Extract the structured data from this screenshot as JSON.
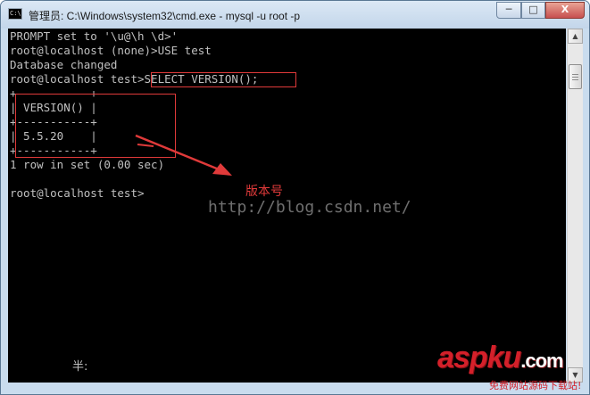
{
  "window": {
    "title": "管理员: C:\\Windows\\system32\\cmd.exe - mysql  -u root -p",
    "app_icon_label": "C:\\",
    "controls": {
      "minimize": "─",
      "maximize": "□",
      "close": "X"
    }
  },
  "console": {
    "lines": [
      "PROMPT set to '\\u@\\h \\d>'",
      "root@localhost (none)>USE test",
      "Database changed",
      "root@localhost test>SELECT VERSION();",
      "+-----------+",
      "| VERSION() |",
      "+-----------+",
      "| 5.5.20    |",
      "+-----------+",
      "1 row in set (0.00 sec)",
      "",
      "root@localhost test>"
    ],
    "ime_status": "半:"
  },
  "scrollbar": {
    "up_arrow": "▲",
    "down_arrow": "▼"
  },
  "annotations": {
    "version_label": "版本号",
    "accent_color": "#e03a3a"
  },
  "watermark": {
    "text": "http://blog.csdn.net/"
  },
  "logo": {
    "brand": "aspku",
    "tld": ".com",
    "tagline": "免费网站源码下载站!"
  }
}
